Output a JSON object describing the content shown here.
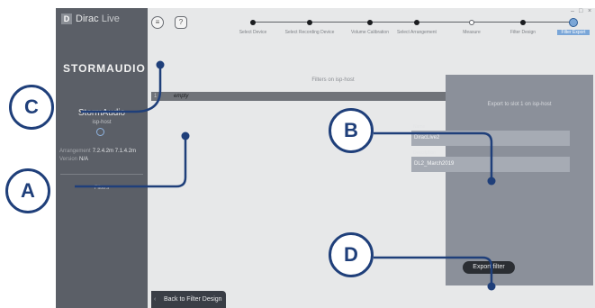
{
  "brand": {
    "badge": "D",
    "name_light": "Dirac",
    "name_rest": "Live"
  },
  "sidebar": {
    "logo_text": "STORMAUDIO",
    "device_name": "StormAudio",
    "device_host": "isp-host",
    "info": [
      {
        "label": "Arrangement",
        "value": "7.2.4.2m 7.1.4.2m"
      },
      {
        "label": "Version",
        "value": "N/A"
      }
    ],
    "filters_label": "Filters"
  },
  "nav": {
    "menu_icon": "≡",
    "help_label": "?"
  },
  "window_controls": {
    "minimize": "–",
    "maximize": "□",
    "close": "×"
  },
  "steps": [
    {
      "label": "Select Device",
      "state": "done"
    },
    {
      "label": "Select Recording Device",
      "state": "done"
    },
    {
      "label": "Volume Calibration",
      "state": "done"
    },
    {
      "label": "Select Arrangement",
      "state": "done"
    },
    {
      "label": "Measure",
      "state": "open"
    },
    {
      "label": "Filter Design",
      "state": "done"
    },
    {
      "label": "Filter Export",
      "state": "active"
    }
  ],
  "filters_panel": {
    "title": "Filters on isp-host",
    "rows": [
      {
        "index": "1",
        "name": "empty"
      }
    ]
  },
  "export_panel": {
    "title": "Export to slot 1 on isp-host",
    "name_label": "Name",
    "name_value": "DiracLive2",
    "description_label": "Description",
    "description_value": "DL2_March2019",
    "export_button": "Export filter"
  },
  "back_button": "Back to Filter Design",
  "callouts": [
    {
      "letter": "A"
    },
    {
      "letter": "B"
    },
    {
      "letter": "C"
    },
    {
      "letter": "D"
    }
  ],
  "colors": {
    "callout": "#1f3f7a",
    "accent": "#7aa6d8",
    "sidebar": "#5b5f67",
    "panel": "#8b909a"
  }
}
